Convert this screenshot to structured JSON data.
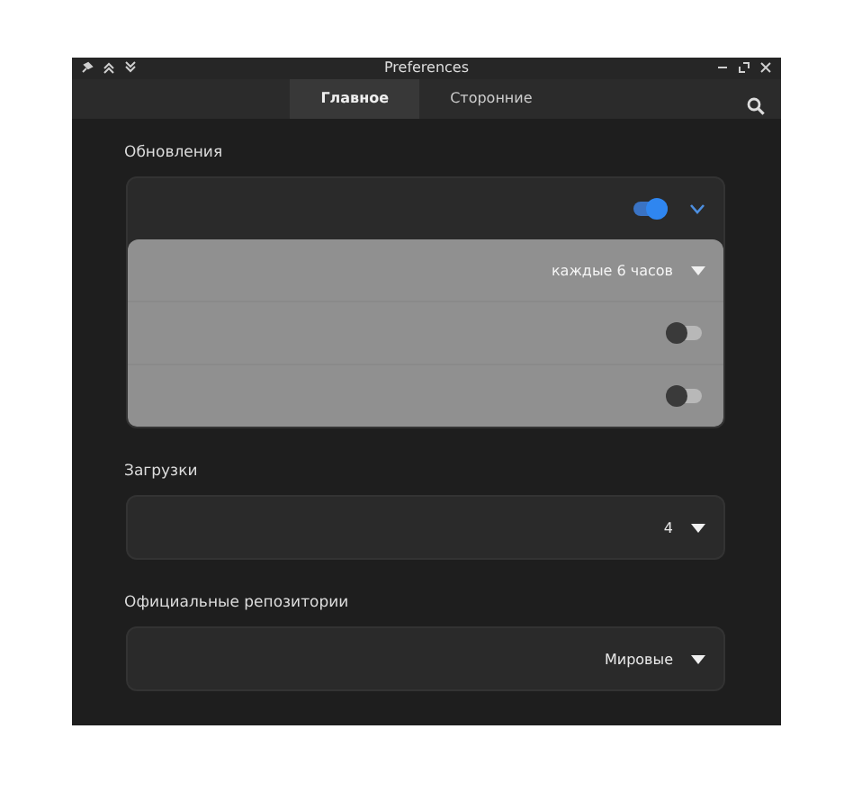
{
  "window": {
    "title": "Preferences"
  },
  "tabs": [
    {
      "label": "Главное",
      "selected": true
    },
    {
      "label": "Сторонние",
      "selected": false
    }
  ],
  "sections": [
    {
      "label": "Обновления",
      "rows": [
        {
          "kind": "expander-switch",
          "on": true,
          "expanded": true,
          "children": [
            {
              "kind": "dropdown",
              "value": "каждые 6 часов"
            },
            {
              "kind": "switch",
              "on": false
            },
            {
              "kind": "switch",
              "on": false
            }
          ]
        }
      ]
    },
    {
      "label": "Загрузки",
      "rows": [
        {
          "kind": "dropdown",
          "value": "4"
        }
      ]
    },
    {
      "label": "Официальные репозитории",
      "rows": [
        {
          "kind": "dropdown",
          "value": "Мировые"
        }
      ]
    }
  ]
}
